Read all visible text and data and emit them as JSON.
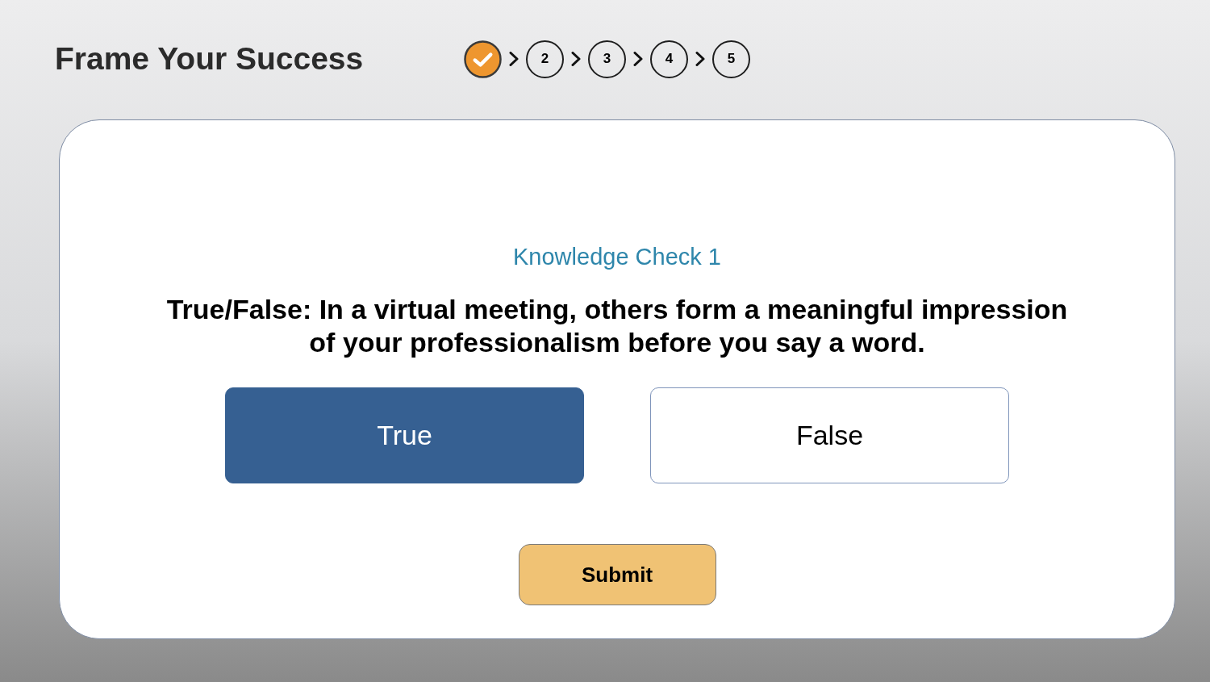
{
  "header": {
    "title": "Frame Your Success"
  },
  "progress_steps": [
    {
      "completed": true
    },
    {
      "label": "2",
      "completed": false
    },
    {
      "label": "3",
      "completed": false
    },
    {
      "label": "4",
      "completed": false
    },
    {
      "label": "5",
      "completed": false
    }
  ],
  "card": {
    "heading": "Knowledge Check 1",
    "question": "True/False: In a virtual meeting, others form a meaningful impression of your professionalism before you say a word.",
    "options": [
      {
        "label": "True",
        "selected": true
      },
      {
        "label": "False",
        "selected": false
      }
    ],
    "submit_button": "Submit"
  }
}
